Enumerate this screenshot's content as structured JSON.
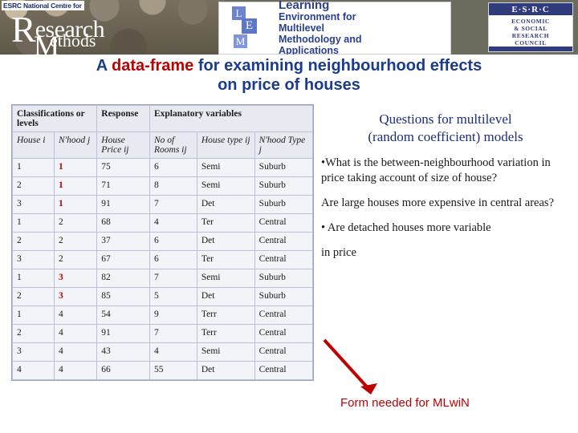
{
  "header": {
    "esrc_badge": "ESRC National Centre for",
    "rm_logo": {
      "r": "R",
      "word1": "esearch",
      "m": "M",
      "word2": "ethods"
    },
    "lemma": {
      "tiles": [
        "L",
        "E",
        "M"
      ],
      "line1": "Learning",
      "line2": "Environment for",
      "line3": "Multilevel",
      "line4": "Methodology and",
      "line5": "Applications"
    },
    "esrc_right": {
      "top": "E·S·R·C",
      "body_line1": "ECONOMIC",
      "body_line2": "&  SOCIAL",
      "body_line3": "RESEARCH",
      "body_line4": "COUNCIL"
    }
  },
  "title": {
    "part1": "A ",
    "highlight": "data-frame",
    "part2": " for examining neighbourhood effects",
    "line2": "on price of houses"
  },
  "table": {
    "headers": [
      "Classifications or levels",
      "Response",
      "Explanatory variables"
    ],
    "subheaders": [
      "House i",
      "N'hood j",
      "House Price ij",
      "No of Rooms ij",
      "House type ij",
      "N'hood Type j"
    ],
    "rows": [
      {
        "house": "1",
        "nhood": "1",
        "price": "75",
        "rooms": "6",
        "type": "Semi",
        "ntype": "Suburb",
        "group": 1
      },
      {
        "house": "2",
        "nhood": "1",
        "price": "71",
        "rooms": "8",
        "type": "Semi",
        "ntype": "Suburb",
        "group": 1
      },
      {
        "house": "3",
        "nhood": "1",
        "price": "91",
        "rooms": "7",
        "type": "Det",
        "ntype": "Suburb",
        "group": 1
      },
      {
        "house": "1",
        "nhood": "2",
        "price": "68",
        "rooms": "4",
        "type": "Ter",
        "ntype": "Central",
        "group": 2
      },
      {
        "house": "2",
        "nhood": "2",
        "price": "37",
        "rooms": "6",
        "type": "Det",
        "ntype": "Central",
        "group": 2
      },
      {
        "house": "3",
        "nhood": "2",
        "price": "67",
        "rooms": "6",
        "type": "Ter",
        "ntype": "Central",
        "group": 2
      },
      {
        "house": "1",
        "nhood": "3",
        "price": "82",
        "rooms": "7",
        "type": "Semi",
        "ntype": "Suburb",
        "group": 3
      },
      {
        "house": "2",
        "nhood": "3",
        "price": "85",
        "rooms": "5",
        "type": "Det",
        "ntype": "Suburb",
        "group": 3
      },
      {
        "house": "1",
        "nhood": "4",
        "price": "54",
        "rooms": "9",
        "type": "Terr",
        "ntype": "Central",
        "group": 4
      },
      {
        "house": "2",
        "nhood": "4",
        "price": "91",
        "rooms": "7",
        "type": "Terr",
        "ntype": "Central",
        "group": 4
      },
      {
        "house": "3",
        "nhood": "4",
        "price": "43",
        "rooms": "4",
        "type": "Semi",
        "ntype": "Central",
        "group": 4
      },
      {
        "house": "4",
        "nhood": "4",
        "price": "66",
        "rooms": "55",
        "type": "Det",
        "ntype": "Central",
        "group": 4
      }
    ]
  },
  "right": {
    "heading_line1": "Questions for multilevel",
    "heading_line2": "(random coefficient) models",
    "bullet1": "•What is the between-neighbourhood variation in price taking account of size of house?",
    "bullet2": "Are  large houses more expensive in central areas?",
    "bullet3": "• Are detached houses more variable",
    "bullet4": "in price",
    "form_note": "Form needed for MLwiN"
  },
  "colors": {
    "title_blue": "#1b3b8f",
    "accent_red": "#c00000",
    "header_band": "#6b6b5e",
    "table_header_bg": "#e8eaf2"
  }
}
